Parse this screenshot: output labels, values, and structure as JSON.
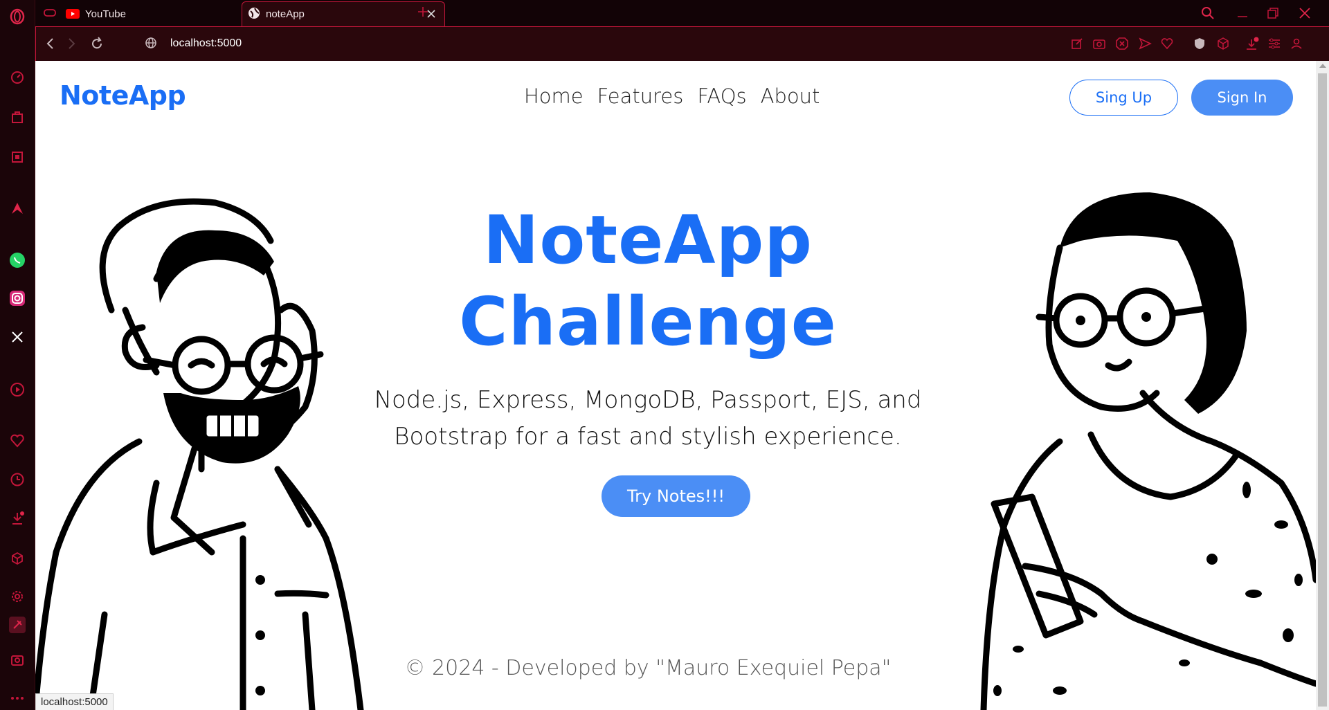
{
  "browser": {
    "tabs": [
      {
        "title": "YouTube",
        "icon": "youtube-icon",
        "active": false
      },
      {
        "title": "noteApp",
        "icon": "globe-icon",
        "active": true
      }
    ],
    "address": "localhost:5000",
    "status_url": "localhost:5000",
    "accent_color": "#c3163a"
  },
  "page": {
    "brand": "NoteApp",
    "nav": [
      "Home",
      "Features",
      "FAQs",
      "About"
    ],
    "signup_label": "Sing Up",
    "signin_label": "Sign In",
    "hero_title_line1": "NoteApp",
    "hero_title_line2": "Challenge",
    "hero_sub_line1": "Node.js, Express, MongoDB, Passport, EJS, and",
    "hero_sub_line2": "Bootstrap for a fast and stylish experience.",
    "cta_label": "Try Notes!!!",
    "footer": "© 2024 - Developed by \"Mauro Exequiel Pepa\"",
    "brand_color": "#1a6ef5",
    "button_color": "#4b8ef5"
  }
}
